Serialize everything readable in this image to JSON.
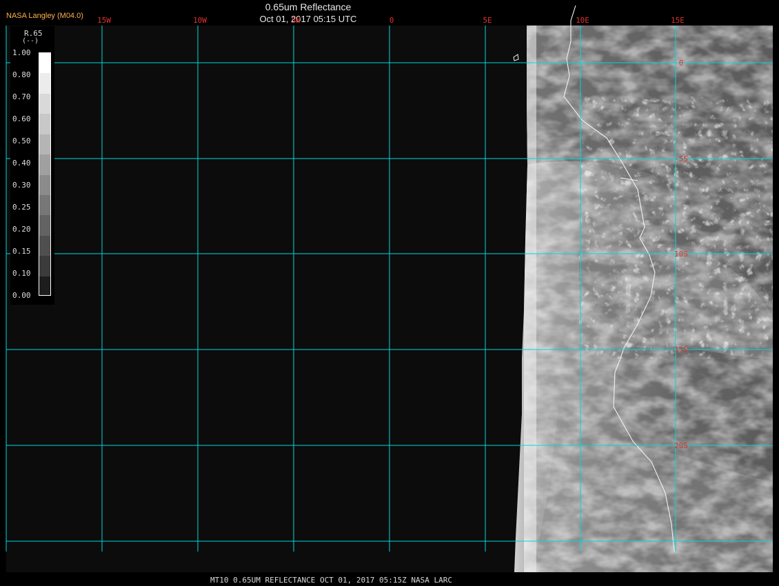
{
  "credit": "NASA Langley (M04.0)",
  "title": "0.65um Reflectance",
  "subtitle": "Oct 01, 2017 05:15 UTC",
  "legend": {
    "variable": "R.65",
    "unit": "(--)",
    "labels": [
      "1.00",
      "0.80",
      "0.70",
      "0.60",
      "0.50",
      "0.40",
      "0.30",
      "0.25",
      "0.20",
      "0.15",
      "0.10",
      "0.00"
    ],
    "colors": [
      "#ffffff",
      "#ececec",
      "#d9d9d9",
      "#c8c8c8",
      "#b5b5b5",
      "#a0a0a0",
      "#8b8b8b",
      "#777777",
      "#636363",
      "#4f4f4f",
      "#3b3b3b",
      "#1d1d1d"
    ]
  },
  "map": {
    "lon_labels": [
      "15W",
      "10W",
      "5W",
      "0",
      "5E",
      "10E",
      "15E"
    ],
    "lat_labels": [
      "0",
      "-5S",
      "10S",
      "15S",
      "20S"
    ],
    "grid_color": "#00d7dc",
    "label_color": "#e2322a"
  },
  "footer": "MT10  0.65UM REFLECTANCE   OCT 01, 2017 05:15Z   NASA LARC"
}
